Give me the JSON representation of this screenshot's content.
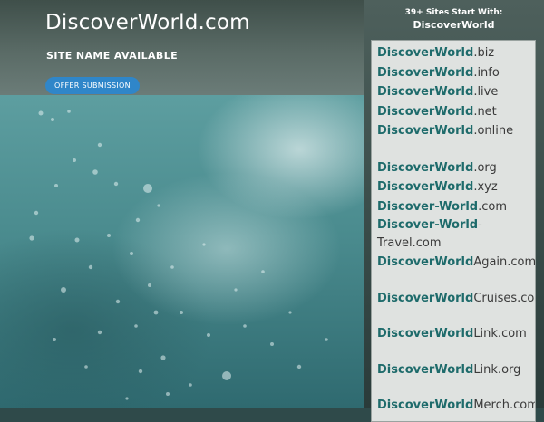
{
  "site": {
    "title": "DiscoverWorld.com",
    "availability": "SITE NAME AVAILABLE",
    "offer_button": "OFFER SUBMISSION"
  },
  "sidebar": {
    "count_heading": "39+ Sites Start With:",
    "keyword": "DiscoverWorld",
    "domains": [
      {
        "bold": "DiscoverWorld",
        "suffix": ".biz"
      },
      {
        "bold": "DiscoverWorld",
        "suffix": ".info"
      },
      {
        "bold": "DiscoverWorld",
        "suffix": ".live"
      },
      {
        "bold": "DiscoverWorld",
        "suffix": ".net"
      },
      {
        "bold": "DiscoverWorld",
        "suffix": ".online"
      },
      {
        "bold": "DiscoverWorld",
        "suffix": ".org"
      },
      {
        "bold": "DiscoverWorld",
        "suffix": ".xyz"
      },
      {
        "bold": "Discover-World",
        "suffix": ".com"
      },
      {
        "bold": "Discover-World",
        "suffix": "-Travel.com"
      },
      {
        "bold": "DiscoverWorld",
        "suffix": "Again.com"
      },
      {
        "bold": "DiscoverWorld",
        "suffix": "Cruises.com"
      },
      {
        "bold": "DiscoverWorld",
        "suffix": "Link.com"
      },
      {
        "bold": "DiscoverWorld",
        "suffix": "Link.org"
      },
      {
        "bold": "DiscoverWorld",
        "suffix": "Merch.com"
      }
    ]
  },
  "colors": {
    "accent_button": "#2f86c9",
    "domain_keyword": "#1e6b6b",
    "panel_background": "#dfe2e0"
  }
}
